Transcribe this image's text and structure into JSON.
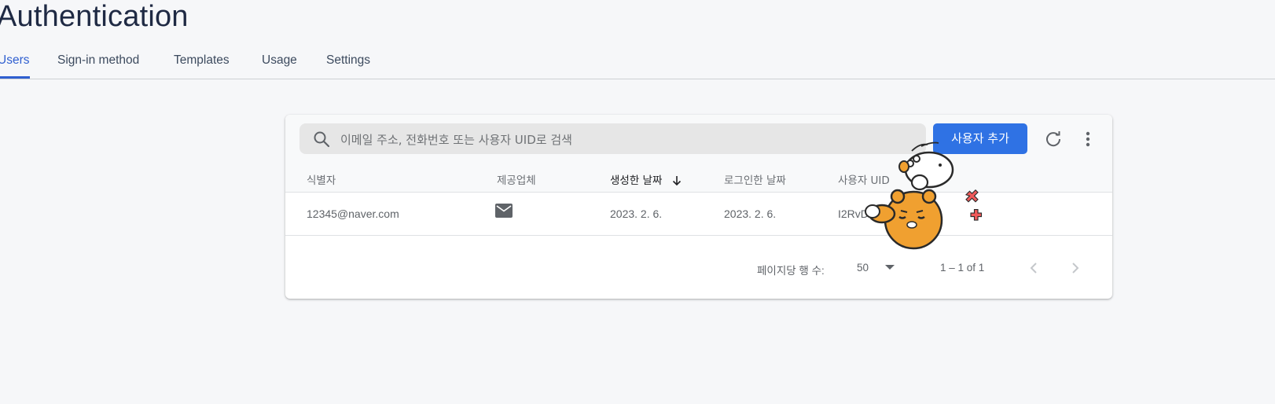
{
  "page": {
    "title": "Authentication"
  },
  "tabs": [
    {
      "label": "Users",
      "active": true
    },
    {
      "label": "Sign-in method",
      "active": false
    },
    {
      "label": "Templates",
      "active": false
    },
    {
      "label": "Usage",
      "active": false
    },
    {
      "label": "Settings",
      "active": false
    }
  ],
  "toolbar": {
    "search_placeholder": "이메일 주소, 전화번호 또는 사용자 UID로 검색",
    "search_value": "",
    "add_user_label": "사용자 추가",
    "refresh_icon": "refresh-icon",
    "more_icon": "more-vert-icon"
  },
  "table": {
    "columns": [
      "식별자",
      "제공업체",
      "생성한 날짜",
      "로그인한 날짜",
      "사용자 UID"
    ],
    "sorted_column": "생성한 날짜",
    "sort_direction": "descending",
    "rows": [
      {
        "identifier": "12345@naver.com",
        "provider_icon": "mail-icon",
        "created": "2023. 2. 6.",
        "signed_in": "2023. 2. 6.",
        "uid": "I2RvDI...L...inc2"
      }
    ]
  },
  "pagination": {
    "rows_per_page_label": "페이지당 행 수:",
    "rows_per_page": "50",
    "range": "1 – 1 of 1"
  },
  "colors": {
    "accent": "#2f72e4",
    "tab_active": "#2f5fd0",
    "background": "#f6f7f9"
  }
}
